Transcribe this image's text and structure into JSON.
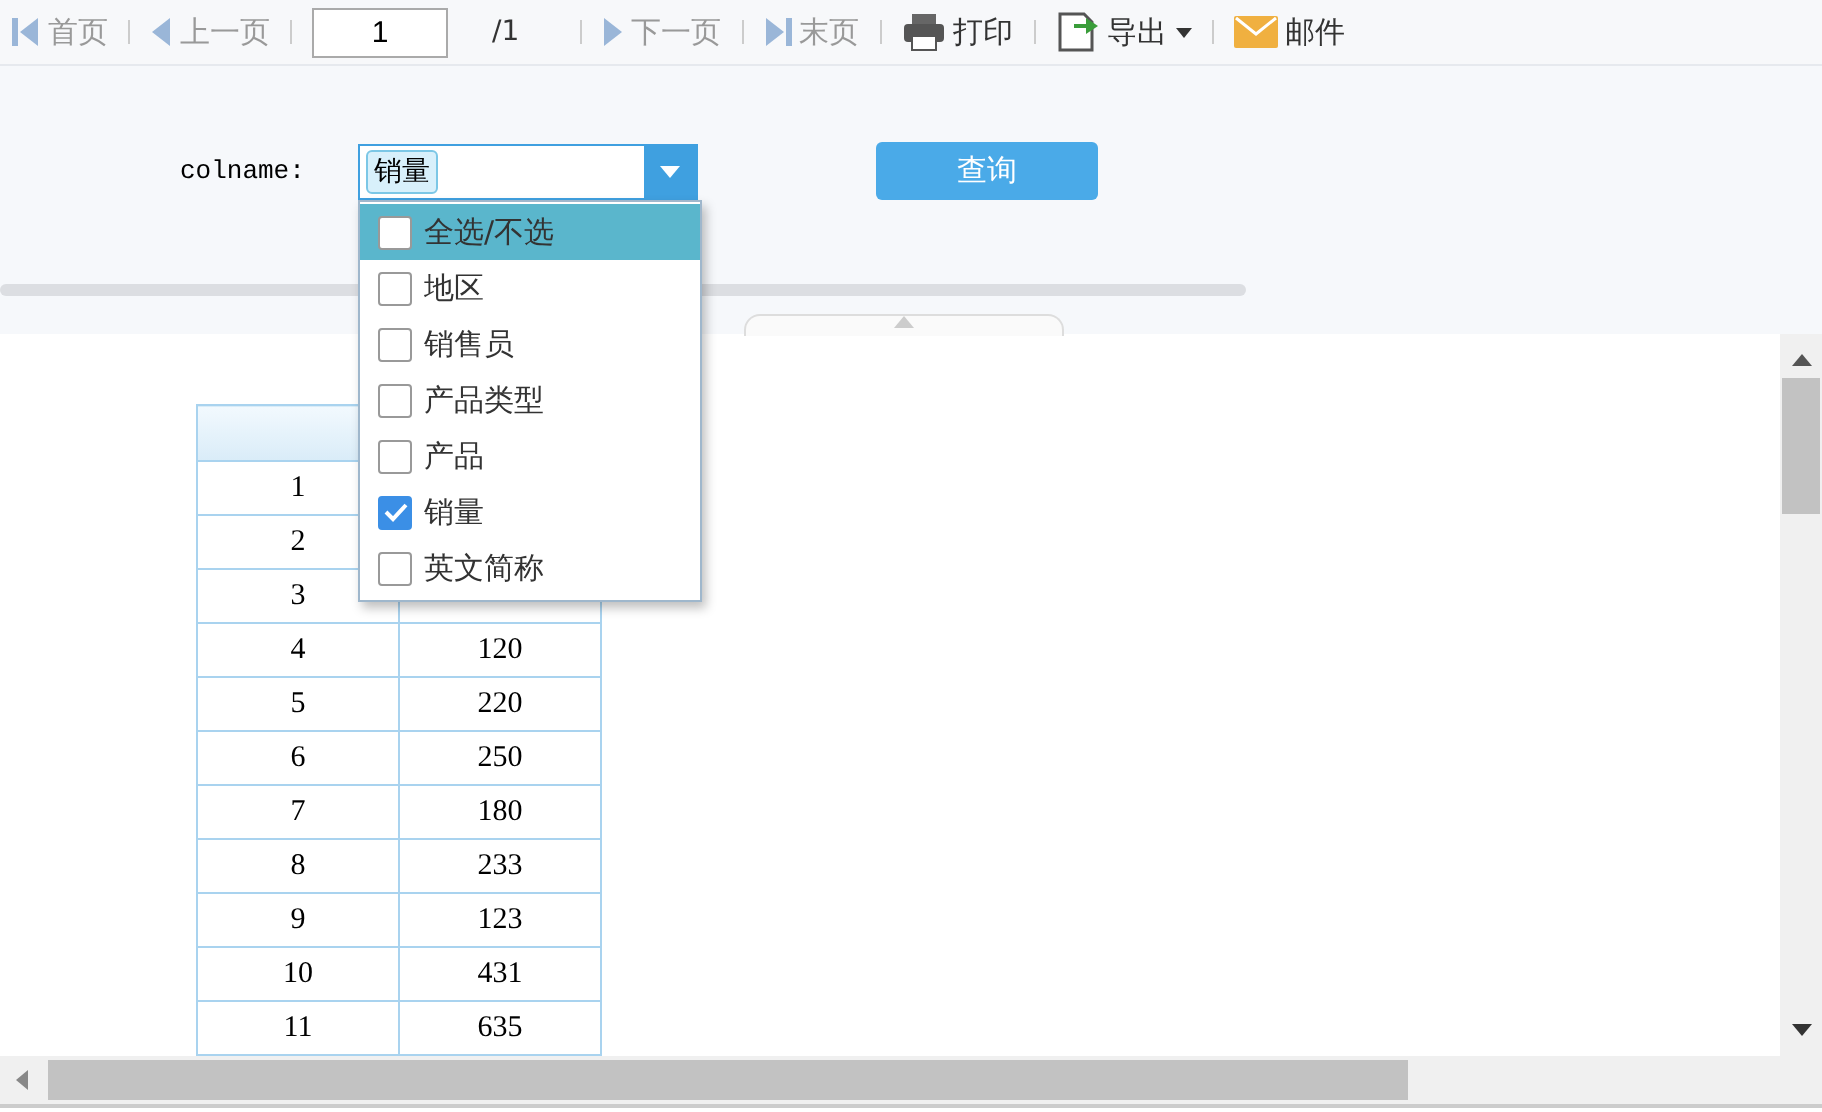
{
  "toolbar": {
    "items": [
      {
        "kind": "first",
        "label": "首页",
        "disabled": true
      },
      {
        "kind": "prev",
        "label": "上一页",
        "disabled": true
      },
      {
        "kind": "page",
        "value": "1",
        "total": "/1"
      },
      {
        "kind": "next",
        "label": "下一页",
        "disabled": true
      },
      {
        "kind": "last",
        "label": "末页",
        "disabled": true
      },
      {
        "kind": "print",
        "label": "打印",
        "disabled": false
      },
      {
        "kind": "export",
        "label": "导出",
        "disabled": false
      },
      {
        "kind": "mail",
        "label": "邮件",
        "disabled": false
      }
    ]
  },
  "form": {
    "label": "colname:",
    "selected_tags": [
      "销量"
    ],
    "query_button": "查询",
    "dropdown": {
      "expanded": true,
      "options": [
        {
          "label": "全选/不选",
          "checked": false,
          "selected": true
        },
        {
          "label": "地区",
          "checked": false,
          "selected": false
        },
        {
          "label": "销售员",
          "checked": false,
          "selected": false
        },
        {
          "label": "产品类型",
          "checked": false,
          "selected": false
        },
        {
          "label": "产品",
          "checked": false,
          "selected": false
        },
        {
          "label": "销量",
          "checked": true,
          "selected": false
        },
        {
          "label": "英文简称",
          "checked": false,
          "selected": false
        }
      ]
    }
  },
  "table": {
    "rows": [
      {
        "column_1": "1"
      },
      {
        "column_1": "2"
      },
      {
        "column_1": "3"
      },
      {
        "column_1": "4",
        "column_2": "120"
      },
      {
        "column_1": "5",
        "column_2": "220"
      },
      {
        "column_1": "6",
        "column_2": "250"
      },
      {
        "column_1": "7",
        "column_2": "180"
      },
      {
        "column_1": "8",
        "column_2": "233"
      },
      {
        "column_1": "9",
        "column_2": "123"
      },
      {
        "column_1": "10",
        "column_2": "431"
      },
      {
        "column_1": "11",
        "column_2": "635"
      }
    ]
  }
}
